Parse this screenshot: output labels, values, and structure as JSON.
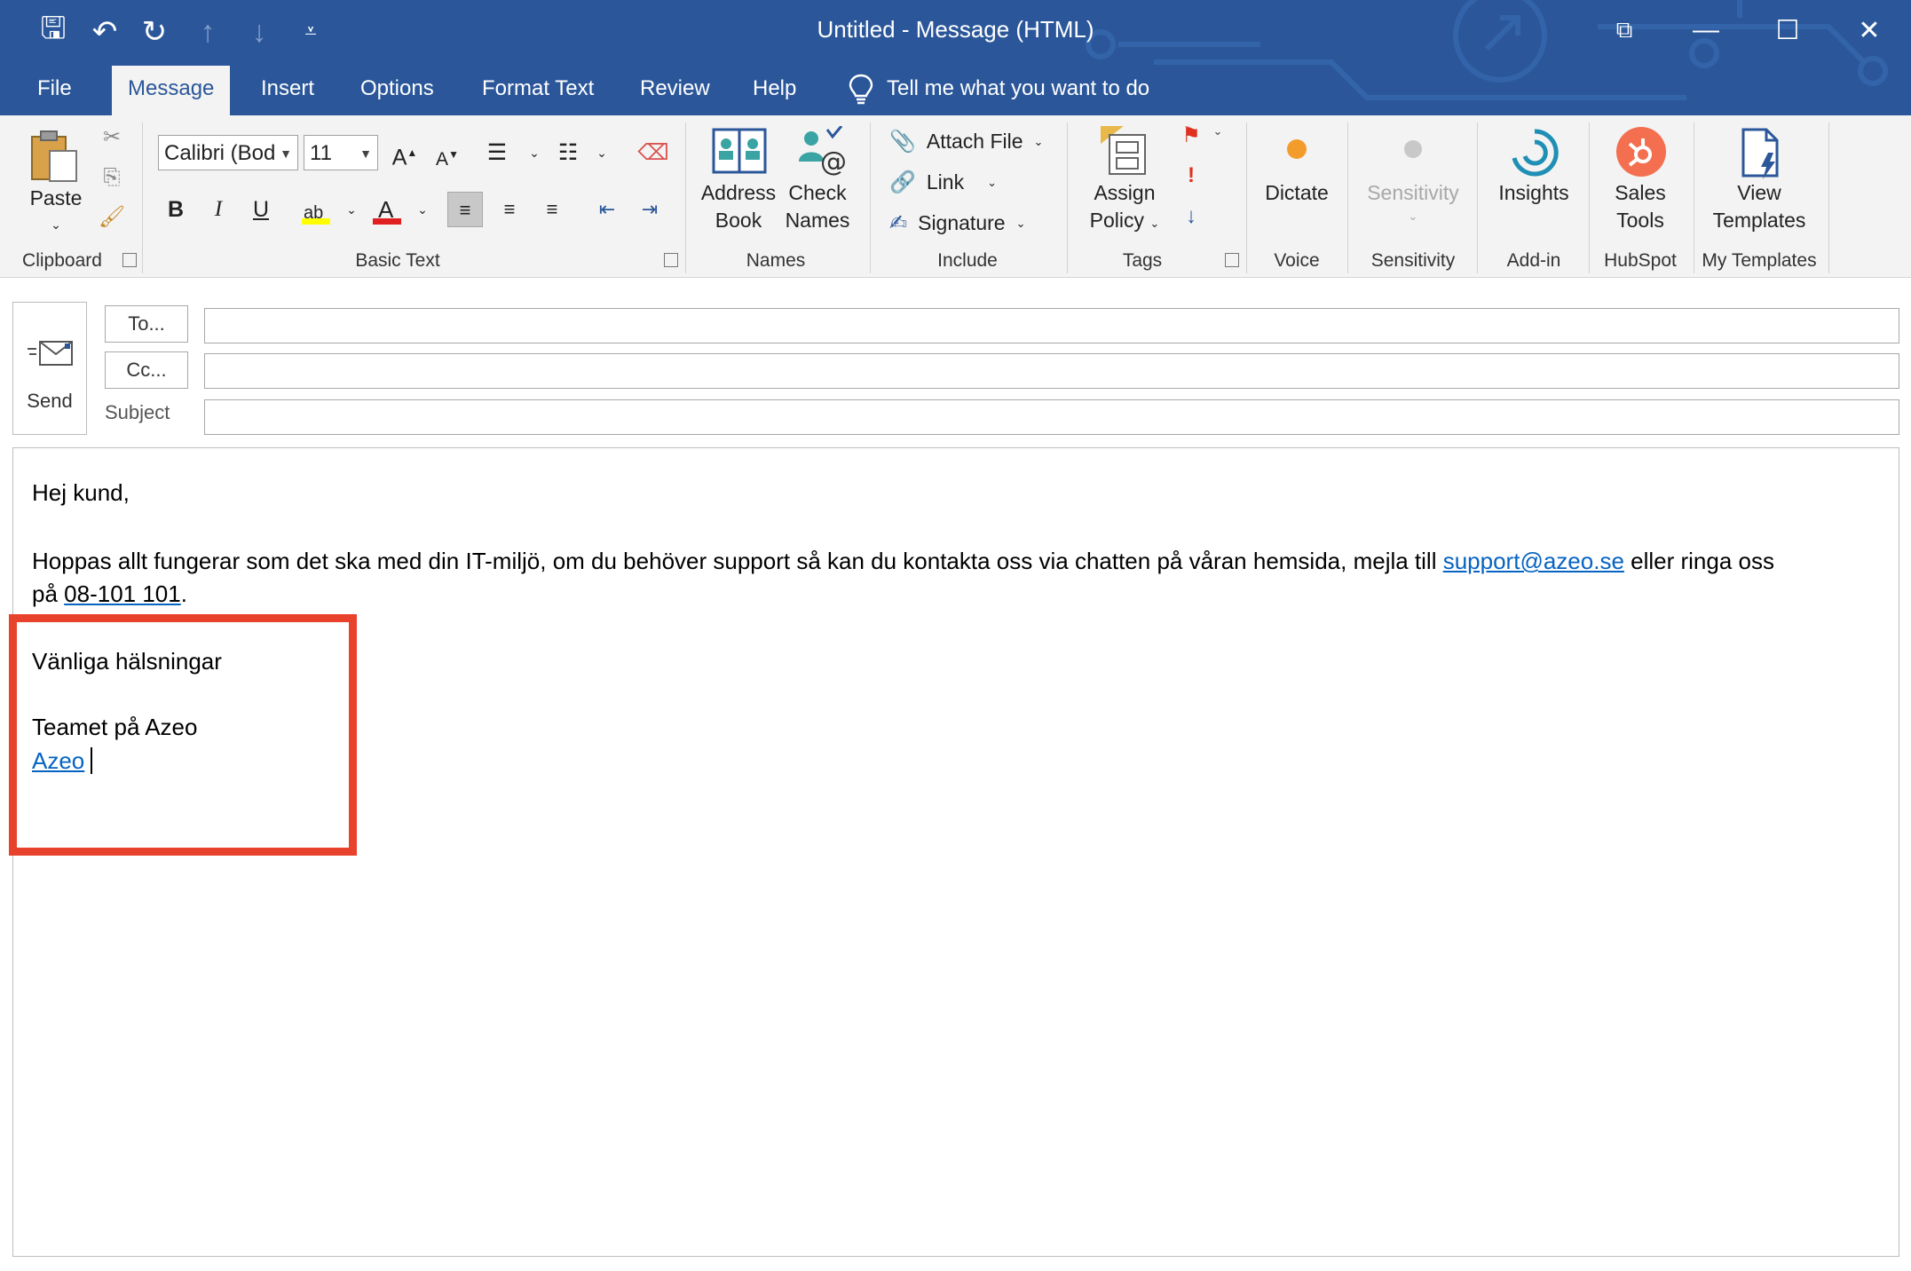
{
  "window": {
    "title": "Untitled  -  Message (HTML)",
    "restore_label": "⧉",
    "minimize_label": "—",
    "maximize_label": "☐",
    "close_label": "✕"
  },
  "quick_access": {
    "save": "🖫",
    "undo": "↶",
    "redo": "↻",
    "up": "↑",
    "down": "↓",
    "customize": "⩡"
  },
  "tabs": [
    "File",
    "Message",
    "Insert",
    "Options",
    "Format Text",
    "Review",
    "Help"
  ],
  "tell_me": "Tell me what you want to do",
  "ribbon": {
    "clipboard": {
      "paste": "Paste",
      "label": "Clipboard"
    },
    "basic_text": {
      "font": "Calibri (Bod",
      "size": "11",
      "grow": "A",
      "shrink": "A",
      "bold": "B",
      "italic": "I",
      "underline": "U",
      "label": "Basic Text"
    },
    "names": {
      "address_book_1": "Address",
      "address_book_2": "Book",
      "check_names_1": "Check",
      "check_names_2": "Names",
      "label": "Names"
    },
    "include": {
      "attach_file": "Attach File",
      "link": "Link",
      "signature": "Signature",
      "label": "Include"
    },
    "tags": {
      "assign_policy_1": "Assign",
      "assign_policy_2": "Policy",
      "label": "Tags"
    },
    "voice": {
      "dictate": "Dictate",
      "label": "Voice"
    },
    "sensitivity": {
      "button": "Sensitivity",
      "label": "Sensitivity"
    },
    "addin": {
      "insights": "Insights",
      "label": "Add-in"
    },
    "hubspot": {
      "sales_1": "Sales",
      "sales_2": "Tools",
      "label": "HubSpot"
    },
    "my_templates": {
      "view_1": "View",
      "view_2": "Templates",
      "label": "My Templates"
    }
  },
  "header": {
    "send": "Send",
    "to_button": "To...",
    "cc_button": "Cc...",
    "subject_label": "Subject",
    "to_value": "",
    "cc_value": "",
    "subject_value": ""
  },
  "body": {
    "greeting": "Hej kund,",
    "para_1a": "Hoppas allt fungerar som det ska med din IT-miljö, om du behöver support så kan du kontakta oss via chatten på våran hemsida, mejla till ",
    "email_link": "support@azeo.se",
    "para_1b": " eller ringa oss",
    "para_2a": "på ",
    "phone": "08-101 101",
    "para_2b": ".",
    "regards": "Vänliga hälsningar",
    "team": "Teamet på Azeo",
    "azeo_link": "Azeo"
  },
  "colors": {
    "title_bar": "#2b579a",
    "ribbon": "#f3f3f3",
    "highlight": "#e8412c",
    "link": "#0563c1"
  }
}
